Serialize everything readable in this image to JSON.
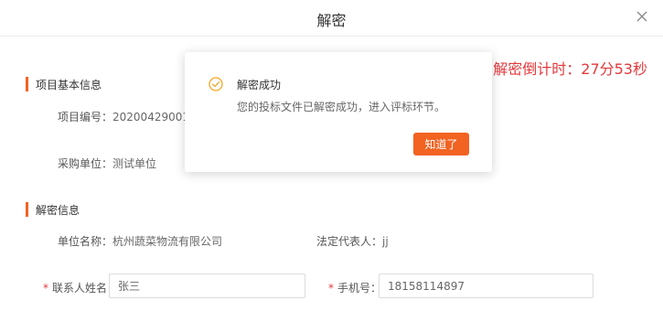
{
  "dialog": {
    "title": "解密"
  },
  "countdown": "解密倒计时：27分53秒",
  "project_section": {
    "title": "项目基本信息",
    "number_label": "项目编号：",
    "number_value": "2020042900100",
    "purchaser_label": "采购单位：",
    "purchaser_value": "测试单位"
  },
  "decrypt_section": {
    "title": "解密信息",
    "company_label": "单位名称：",
    "company_value": "杭州蔬菜物流有限公司",
    "legal_rep_label": "法定代表人：",
    "legal_rep_value": "jj",
    "contact_label": "联系人姓名：",
    "contact_value": "张三",
    "phone_label": "手机号：",
    "phone_value": "18158114897",
    "required_mark": "*"
  },
  "popup": {
    "title": "解密成功",
    "message": "您的投标文件已解密成功，进入评标环节。",
    "ok_label": "知道了",
    "icon": "check-circle-icon"
  },
  "colors": {
    "accent": "#f26322",
    "danger": "#e4393c",
    "success_icon": "#f5a623"
  }
}
